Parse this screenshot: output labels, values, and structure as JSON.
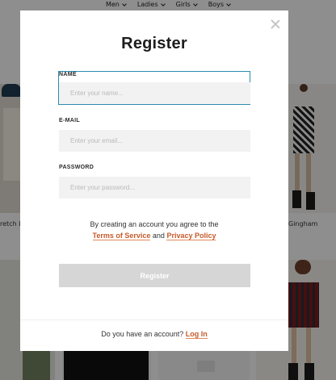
{
  "nav": {
    "items": [
      "Men",
      "Ladies",
      "Girls",
      "Boys"
    ]
  },
  "background": {
    "product_left_name": "retch L",
    "product_right_name": "Gingham"
  },
  "modal": {
    "title": "Register",
    "fields": {
      "name": {
        "label": "NAME",
        "placeholder": "Enter your name..."
      },
      "email": {
        "label": "E-MAIL",
        "placeholder": "Enter your email..."
      },
      "password": {
        "label": "PASSWORD",
        "placeholder": "Enter your password..."
      }
    },
    "terms": {
      "prefix": "By creating an account you agree to the",
      "terms_link": "Terms of Service",
      "and": "and",
      "privacy_link": "Privacy Policy"
    },
    "register_label": "Register",
    "login": {
      "prompt": "Do you have an account?",
      "link": "Log In"
    }
  },
  "colors": {
    "accent": "#c75a2a",
    "focus_border": "#2b8bb0",
    "button_disabled": "#d6d6d6"
  }
}
